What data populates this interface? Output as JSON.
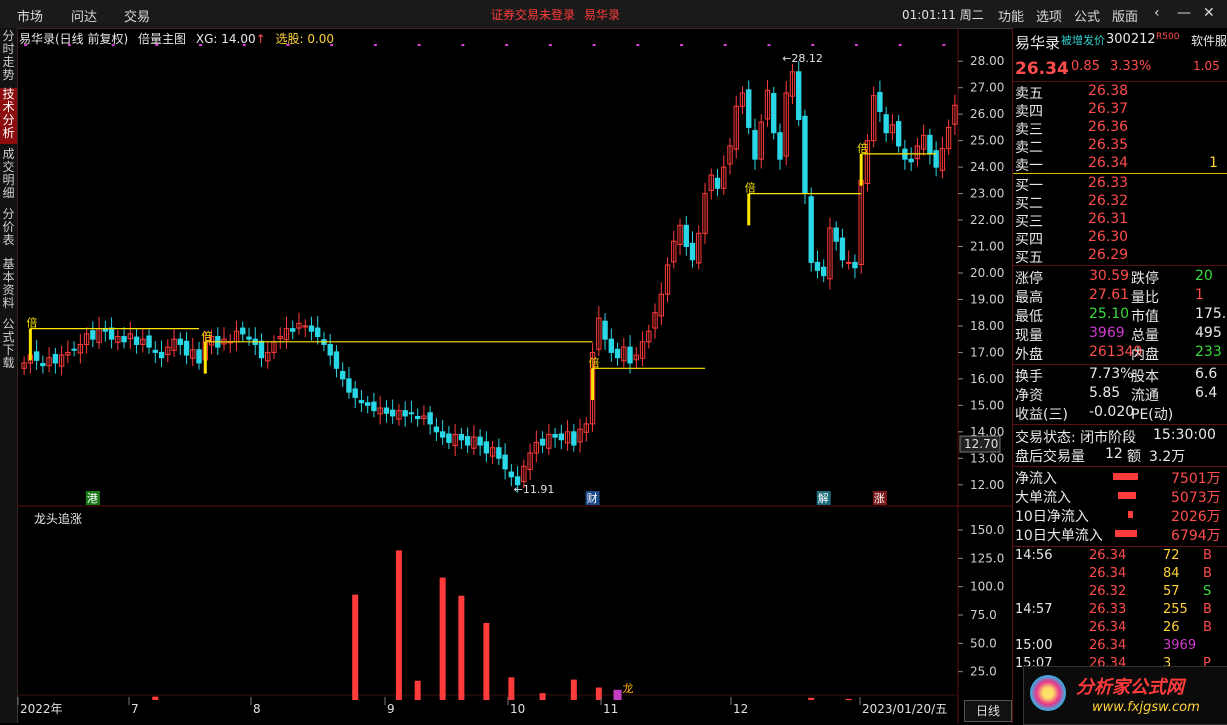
{
  "menubar": {
    "items": [
      "市场",
      "问达",
      "交易"
    ],
    "warning": "证券交易未登录",
    "stock_name": "易华录",
    "clock": "01:01:11 周二",
    "right_items": [
      "功能",
      "选项",
      "公式",
      "版面"
    ]
  },
  "left_tabs": [
    "分时走势",
    "技术分析",
    "成交明细",
    "分价表",
    "基本资料",
    "公式下载"
  ],
  "active_tab": "技术分析",
  "infobar": {
    "title": "易华录(日线 前复权)",
    "formula": "倍量主图",
    "xg": "XG: 14.00",
    "xg_arrow": "↑",
    "pick": "选股: 0.00"
  },
  "sub_indicator": "龙头追涨",
  "chart_data": [
    {
      "type": "candlestick",
      "title": "",
      "y_ticks": [
        "28.00",
        "27.00",
        "26.00",
        "25.00",
        "24.00",
        "23.00",
        "22.00",
        "21.00",
        "20.00",
        "19.00",
        "18.00",
        "17.00",
        "16.00",
        "15.00",
        "14.00",
        "13.00",
        "12.00"
      ],
      "ylim": [
        11.5,
        28.5
      ],
      "current_price_tag": "12.70",
      "annotations": [
        "←28.12",
        "←11.91",
        "倍",
        "倍",
        "倍",
        "倍",
        "倍"
      ],
      "markers": [
        "港",
        "财",
        "解",
        "涨"
      ],
      "volume_multiple_lines": [
        {
          "level": 17.9,
          "from": 1,
          "to": 28
        },
        {
          "level": 17.4,
          "from": 29,
          "to": 91
        },
        {
          "level": 16.4,
          "from": 91,
          "to": 109
        },
        {
          "level": 23.0,
          "from": 116,
          "to": 134
        },
        {
          "level": 24.5,
          "from": 134,
          "to": 146
        }
      ],
      "closes": [
        16.6,
        16.9,
        16.7,
        16.5,
        16.8,
        16.6,
        16.9,
        17.0,
        17.1,
        17.3,
        17.7,
        17.5,
        17.9,
        17.8,
        17.5,
        17.6,
        17.4,
        17.7,
        17.3,
        17.5,
        17.2,
        17.0,
        16.8,
        17.2,
        17.5,
        17.3,
        16.9,
        17.1,
        16.6,
        17.4,
        17.6,
        17.2,
        17.5,
        17.4,
        17.8,
        17.7,
        17.5,
        17.3,
        16.8,
        17.0,
        17.4,
        17.6,
        17.9,
        17.8,
        18.1,
        18.0,
        17.8,
        17.6,
        17.3,
        16.9,
        16.4,
        16.0,
        15.5,
        15.3,
        15.1,
        15.0,
        14.8,
        14.9,
        14.7,
        14.6,
        14.8,
        14.6,
        14.7,
        14.5,
        14.6,
        14.3,
        14.0,
        13.8,
        13.6,
        13.9,
        13.7,
        13.5,
        13.8,
        13.5,
        13.2,
        13.4,
        13.0,
        12.6,
        12.3,
        12.0,
        12.7,
        13.2,
        13.6,
        13.5,
        13.9,
        13.8,
        13.7,
        14.0,
        13.5,
        14.1,
        14.3,
        17.0,
        18.3,
        17.5,
        17.0,
        16.8,
        17.2,
        16.6,
        16.9,
        17.4,
        17.8,
        18.5,
        19.2,
        20.3,
        21.2,
        21.8,
        21.0,
        20.5,
        21.5,
        23.0,
        23.7,
        23.2,
        24.0,
        24.8,
        26.3,
        26.8,
        25.5,
        24.3,
        25.7,
        26.9,
        25.3,
        24.3,
        26.8,
        27.6,
        25.8,
        23.0,
        20.4,
        20.1,
        19.9,
        21.7,
        21.2,
        20.5,
        20.4,
        20.2,
        23.5,
        25.0,
        26.7,
        26.1,
        25.3,
        25.6,
        24.8,
        24.3,
        24.2,
        24.8,
        25.2,
        24.5,
        24.0,
        24.7,
        25.5,
        26.34
      ],
      "sub_chart": {
        "name": "龙头追涨",
        "y_ticks": [
          "150.0",
          "125.0",
          "100.0",
          "75.0",
          "50.0",
          "25.0"
        ],
        "ylim": [
          0,
          165
        ],
        "bars": [
          {
            "i": 21,
            "v": 3
          },
          {
            "i": 53,
            "v": 93
          },
          {
            "i": 60,
            "v": 132
          },
          {
            "i": 63,
            "v": 17
          },
          {
            "i": 67,
            "v": 108
          },
          {
            "i": 70,
            "v": 92
          },
          {
            "i": 74,
            "v": 68
          },
          {
            "i": 78,
            "v": 20
          },
          {
            "i": 83,
            "v": 6
          },
          {
            "i": 88,
            "v": 18
          },
          {
            "i": 92,
            "v": 11
          },
          {
            "i": 126,
            "v": 2
          },
          {
            "i": 132,
            "v": 1
          }
        ],
        "marker_bar": {
          "i": 95,
          "v": 9
        },
        "marker_label": "龙"
      },
      "x_labels": [
        "2022年",
        "7",
        "8",
        "9",
        "10",
        "11",
        "12",
        "2023/01/20/五"
      ]
    }
  ],
  "axis_button": "日线",
  "right_panel": {
    "name": "易华录",
    "tag": "被增发价",
    "code": "300212",
    "rank": "R500",
    "side_label": "软件服",
    "price": "26.34",
    "change": "0.85",
    "pct": "3.33%",
    "right_edge_value": "1.05",
    "sells": [
      [
        "卖五",
        "26.38",
        ""
      ],
      [
        "卖四",
        "26.37",
        ""
      ],
      [
        "卖三",
        "26.36",
        ""
      ],
      [
        "卖二",
        "26.35",
        ""
      ],
      [
        "卖一",
        "26.34",
        "1"
      ]
    ],
    "buys": [
      [
        "买一",
        "26.33"
      ],
      [
        "买二",
        "26.32"
      ],
      [
        "买三",
        "26.31"
      ],
      [
        "买四",
        "26.30"
      ],
      [
        "买五",
        "26.29"
      ]
    ],
    "stats": [
      [
        "涨停",
        "30.59",
        "跌停",
        "20"
      ],
      [
        "最高",
        "27.61",
        "量比",
        "1"
      ],
      [
        "最低",
        "25.10",
        "市值",
        "175."
      ],
      [
        "现量",
        "3969",
        "总量",
        "495"
      ],
      [
        "外盘",
        "261349",
        "内盘",
        "233"
      ]
    ],
    "stats2": [
      [
        "换手",
        "7.73%",
        "股本",
        "6.6"
      ],
      [
        "净资",
        "5.85",
        "流通",
        "6.4"
      ],
      [
        "收益(三)",
        "-0.020",
        "PE(动)",
        ""
      ]
    ],
    "status": [
      "交易状态: 闭市阶段",
      "15:30:00"
    ],
    "after": [
      "盘后交易量",
      "12",
      "额",
      "3.2万"
    ],
    "flows": [
      [
        "净流入",
        "7501万",
        55
      ],
      [
        "大单流入",
        "5073万",
        40
      ],
      [
        "10日净流入",
        "2026万",
        10
      ],
      [
        "10日大单流入",
        "6794万",
        48
      ]
    ],
    "ticks": [
      [
        "14:56",
        "26.34",
        "72",
        "B"
      ],
      [
        "",
        "26.34",
        "84",
        "B"
      ],
      [
        "",
        "26.32",
        "57",
        "S"
      ],
      [
        "14:57",
        "26.33",
        "255",
        "B"
      ],
      [
        "",
        "26.34",
        "26",
        "B"
      ],
      [
        "15:00",
        "26.34",
        "3969",
        ""
      ],
      [
        "15:07",
        "26.34",
        "3",
        "P"
      ]
    ],
    "logo": "分析家公式网",
    "logo_url": "www.fxjgsw.com"
  },
  "colors": {
    "up": "#ff3b3b",
    "down": "#2ad7e6",
    "ma": "#ffe500",
    "grid": "#5a1010"
  }
}
